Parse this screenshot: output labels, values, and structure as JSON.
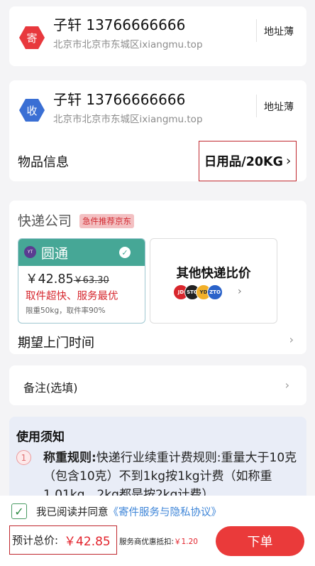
{
  "sender": {
    "badge": "寄",
    "name": "子轩 13766666666",
    "address": "北京市北京市东城区ixiangmu.top",
    "address_book": "地址薄",
    "badge_color": "#e8383d"
  },
  "receiver": {
    "badge": "收",
    "name": "子轩 13766666666",
    "address": "北京市北京市东城区ixiangmu.top",
    "address_book": "地址薄",
    "badge_color": "#3a6fd4"
  },
  "goods": {
    "label": "物品信息",
    "value": "日用品/20KG",
    "chevron": "›"
  },
  "courier": {
    "title": "快递公司",
    "tag": "急件推荐京东",
    "selected": {
      "logo_text": "YT",
      "name": "圆通",
      "check": "✓",
      "price": "￥42.85",
      "original_price": "￥63.30",
      "slogan": "取件超快、服务最优",
      "limit": "限重50kg，取件率90%"
    },
    "other": {
      "title": "其他快递比价",
      "logos": [
        "JD",
        "STO",
        "YD",
        "ZTO"
      ],
      "chevron": "›"
    },
    "pickup_time_label": "期望上门时间",
    "pickup_chevron": "›"
  },
  "note": {
    "label": "备注(选填)",
    "chevron": "›"
  },
  "notice": {
    "title": "使用须知",
    "items": [
      {
        "num": "1",
        "bold": "称重规则:",
        "text": "快递行业续重计费规则:重量大于10克（包含10克）不到1kg按1kg计费（如称重1.01kg，2kg都是按2kg计费）"
      }
    ]
  },
  "footer": {
    "check": "✓",
    "agree_text": "我已阅读并同意",
    "agree_link": "《寄件服务与隐私协议》",
    "total_label": "预计总价:",
    "total_amount": "￥42.85",
    "discount_label": "服务商优惠抵扣:",
    "discount_amount": "￥1.20",
    "order_button": "下单"
  }
}
